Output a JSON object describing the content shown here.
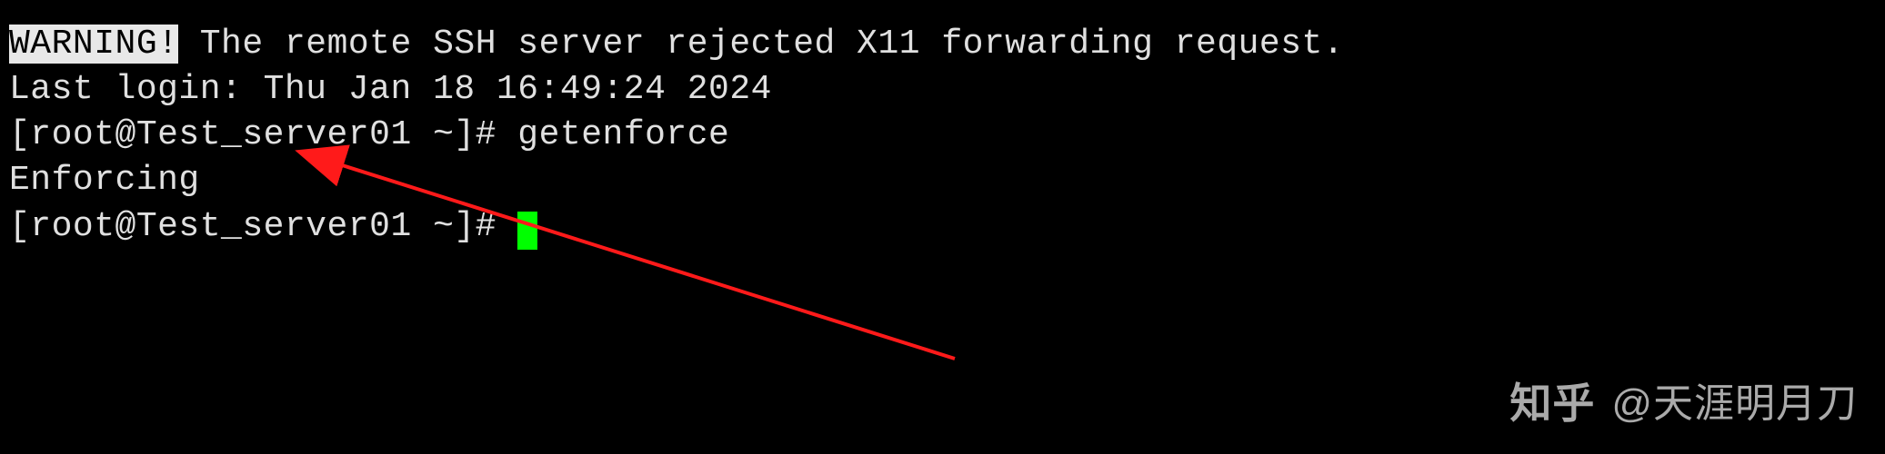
{
  "terminal": {
    "warning_label": "WARNING!",
    "warning_message": " The remote SSH server rejected X11 forwarding request.",
    "last_login": "Last login: Thu Jan 18 16:49:24 2024",
    "prompt1": "[root@Test_server01 ~]# ",
    "command1": "getenforce",
    "output1": "Enforcing",
    "prompt2": "[root@Test_server01 ~]# "
  },
  "watermark": {
    "logo": "知乎",
    "author": "@天涯明月刀"
  }
}
